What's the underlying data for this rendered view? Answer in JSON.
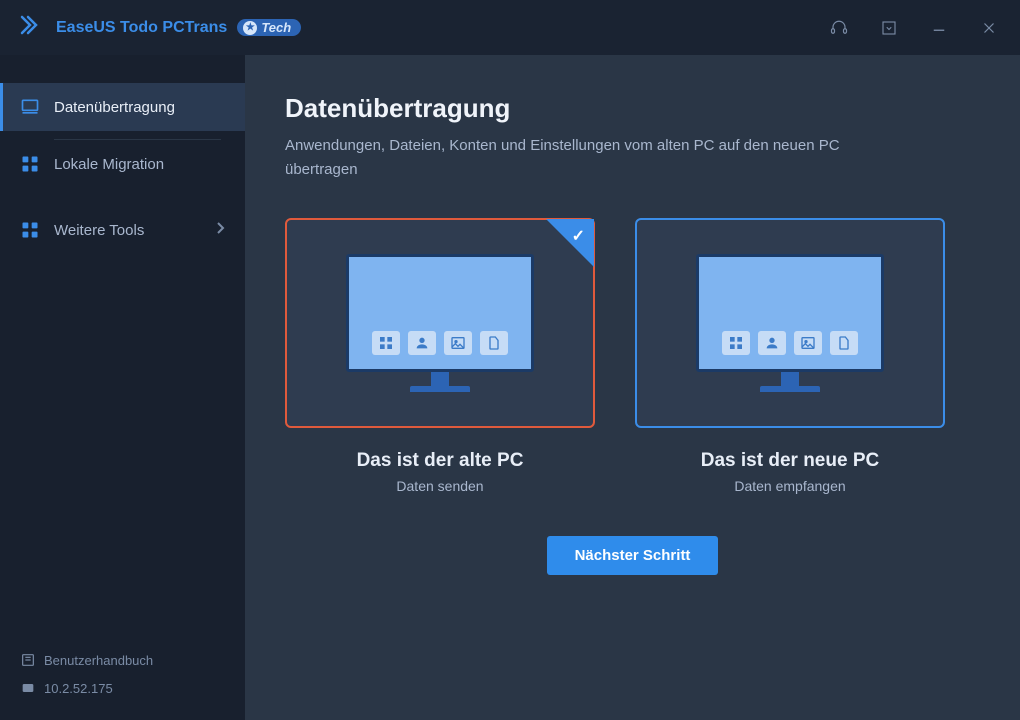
{
  "titlebar": {
    "product_name": "EaseUS Todo PCTrans",
    "badge_text": "Tech"
  },
  "sidebar": {
    "items": [
      {
        "label": "Datenübertragung"
      },
      {
        "label": "Lokale Migration"
      },
      {
        "label": "Weitere Tools"
      }
    ],
    "footer": {
      "manual_label": "Benutzerhandbuch",
      "ip_address": "10.2.52.175"
    }
  },
  "main": {
    "title": "Datenübertragung",
    "description": "Anwendungen, Dateien, Konten und Einstellungen vom alten PC auf den neuen PC übertragen",
    "cards": [
      {
        "title": "Das ist der alte PC",
        "subtitle": "Daten senden"
      },
      {
        "title": "Das ist der neue PC",
        "subtitle": "Daten empfangen"
      }
    ],
    "next_button": "Nächster Schritt"
  }
}
